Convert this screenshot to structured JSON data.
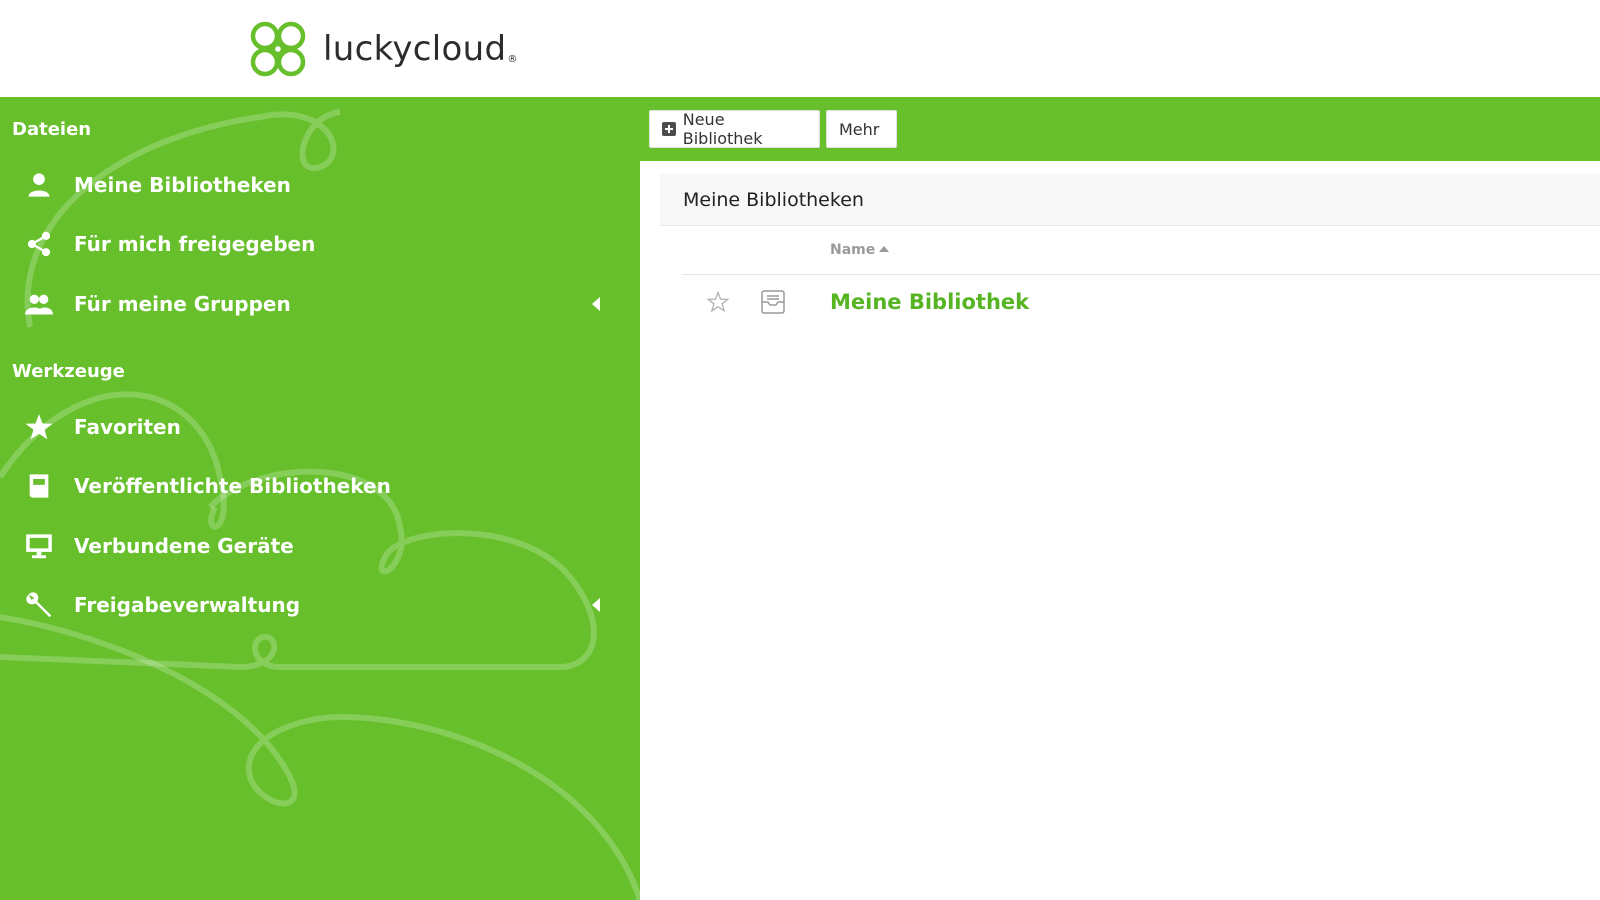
{
  "brand": {
    "name": "luckycloud",
    "mark": "®",
    "icon": "clover-logo-icon",
    "accent": "#66bf2b"
  },
  "sidebar": {
    "sections": [
      {
        "title": "Dateien",
        "items": [
          {
            "label": "Meine Bibliotheken",
            "icon": "user-icon"
          },
          {
            "label": "Für mich freigegeben",
            "icon": "share-icon"
          },
          {
            "label": "Für meine Gruppen",
            "icon": "group-icon",
            "expandable": true
          }
        ]
      },
      {
        "title": "Werkzeuge",
        "items": [
          {
            "label": "Favoriten",
            "icon": "star-icon"
          },
          {
            "label": "Veröffentlichte Bibliotheken",
            "icon": "book-icon"
          },
          {
            "label": "Verbundene Geräte",
            "icon": "monitor-icon"
          },
          {
            "label": "Freigabeverwaltung",
            "icon": "wrench-icon",
            "expandable": true
          }
        ]
      }
    ]
  },
  "toolbar": {
    "new_library_label": "Neue Bibliothek",
    "more_label": "Mehr"
  },
  "main": {
    "title": "Meine Bibliotheken",
    "columns": {
      "name": "Name"
    },
    "rows": [
      {
        "name": "Meine Bibliothek",
        "starred": false,
        "icon": "library-icon"
      }
    ]
  }
}
